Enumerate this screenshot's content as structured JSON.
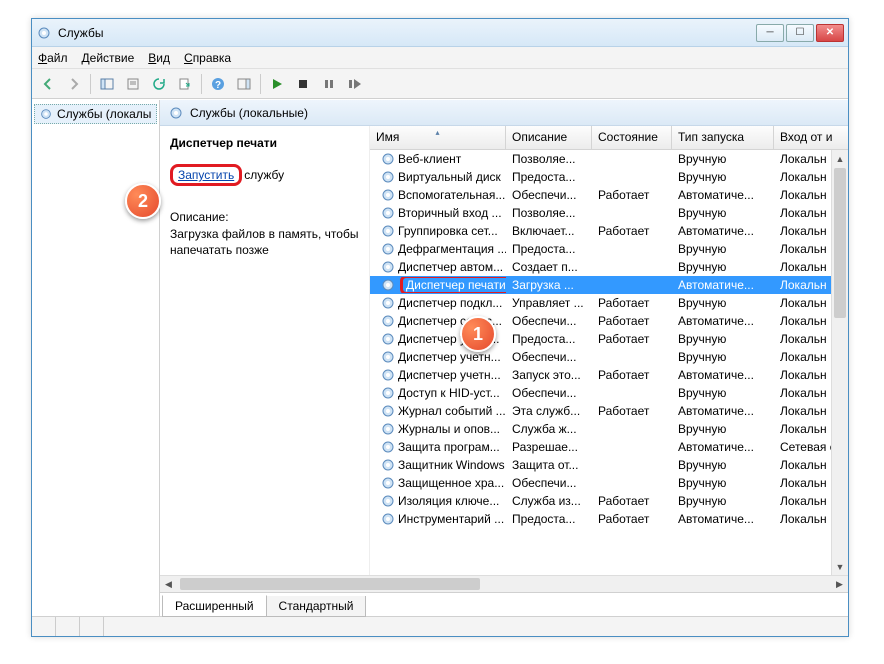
{
  "window": {
    "title": "Службы"
  },
  "menu": {
    "file": "Файл",
    "action": "Действие",
    "view": "Вид",
    "help": "Справка"
  },
  "tree": {
    "root": "Службы (локалы"
  },
  "main_header": "Службы (локальные)",
  "detail": {
    "title": "Диспетчер печати",
    "start_link": "Запустить",
    "start_rest": "службу",
    "desc_label": "Описание:",
    "desc_text": "Загрузка файлов в память, чтобы напечатать позже"
  },
  "columns": [
    "Имя",
    "Описание",
    "Состояние",
    "Тип запуска",
    "Вход от и"
  ],
  "rows": [
    {
      "name": "Веб-клиент",
      "desc": "Позволяе...",
      "state": "",
      "start": "Вручную",
      "logon": "Локальн"
    },
    {
      "name": "Виртуальный диск",
      "desc": "Предоста...",
      "state": "",
      "start": "Вручную",
      "logon": "Локальн"
    },
    {
      "name": "Вспомогательная...",
      "desc": "Обеспечи...",
      "state": "Работает",
      "start": "Автоматиче...",
      "logon": "Локальн"
    },
    {
      "name": "Вторичный вход ...",
      "desc": "Позволяе...",
      "state": "",
      "start": "Вручную",
      "logon": "Локальн"
    },
    {
      "name": "Группировка сет...",
      "desc": "Включает...",
      "state": "Работает",
      "start": "Автоматиче...",
      "logon": "Локальн"
    },
    {
      "name": "Дефрагментация ...",
      "desc": "Предоста...",
      "state": "",
      "start": "Вручную",
      "logon": "Локальн"
    },
    {
      "name": "Диспетчер автом...",
      "desc": "Создает п...",
      "state": "",
      "start": "Вручную",
      "logon": "Локальн"
    },
    {
      "name": "Диспетчер печати",
      "desc": "Загрузка ...",
      "state": "",
      "start": "Автоматиче...",
      "logon": "Локальн",
      "selected": true,
      "highlight": true
    },
    {
      "name": "Диспетчер подкл...",
      "desc": "Управляет ...",
      "state": "Работает",
      "start": "Вручную",
      "logon": "Локальн"
    },
    {
      "name": "Диспетчер сеанс...",
      "desc": "Обеспечи...",
      "state": "Работает",
      "start": "Автоматиче...",
      "logon": "Локальн"
    },
    {
      "name": "Диспетчер удост...",
      "desc": "Предоста...",
      "state": "Работает",
      "start": "Вручную",
      "logon": "Локальн"
    },
    {
      "name": "Диспетчер учетн...",
      "desc": "Обеспечи...",
      "state": "",
      "start": "Вручную",
      "logon": "Локальн"
    },
    {
      "name": "Диспетчер учетн...",
      "desc": "Запуск это...",
      "state": "Работает",
      "start": "Автоматиче...",
      "logon": "Локальн"
    },
    {
      "name": "Доступ к HID-уст...",
      "desc": "Обеспечи...",
      "state": "",
      "start": "Вручную",
      "logon": "Локальн"
    },
    {
      "name": "Журнал событий ...",
      "desc": "Эта служб...",
      "state": "Работает",
      "start": "Автоматиче...",
      "logon": "Локальн"
    },
    {
      "name": "Журналы и опов...",
      "desc": "Служба ж...",
      "state": "",
      "start": "Вручную",
      "logon": "Локальн"
    },
    {
      "name": "Защита програм...",
      "desc": "Разрешае...",
      "state": "",
      "start": "Автоматиче...",
      "logon": "Сетевая с"
    },
    {
      "name": "Защитник Windows",
      "desc": "Защита от...",
      "state": "",
      "start": "Вручную",
      "logon": "Локальн"
    },
    {
      "name": "Защищенное хра...",
      "desc": "Обеспечи...",
      "state": "",
      "start": "Вручную",
      "logon": "Локальн"
    },
    {
      "name": "Изоляция ключе...",
      "desc": "Служба из...",
      "state": "Работает",
      "start": "Вручную",
      "logon": "Локальн"
    },
    {
      "name": "Инструментарий ...",
      "desc": "Предоста...",
      "state": "Работает",
      "start": "Автоматиче...",
      "logon": "Локальн"
    }
  ],
  "tabs": {
    "extended": "Расширенный",
    "standard": "Стандартный"
  },
  "callouts": {
    "one": "1",
    "two": "2"
  }
}
